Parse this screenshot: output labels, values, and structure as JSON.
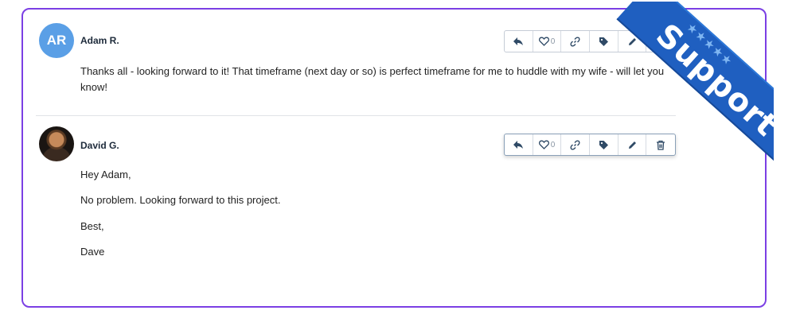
{
  "posts": [
    {
      "author": "Adam R.",
      "avatar_initials": "AR",
      "avatar_color": "#5a9fe6",
      "body": [
        "Thanks all - looking forward to it!  That timeframe (next day or so) is perfect timeframe for me to huddle with my wife - will let you know!"
      ],
      "like_count": "0"
    },
    {
      "author": "David G.",
      "body": [
        "Hey Adam,",
        "No problem. Looking forward to this project.",
        "Best,",
        "Dave"
      ],
      "like_count": "0"
    }
  ],
  "ribbon": {
    "label": "Support",
    "stars": "★★★★★",
    "color": "#1f5fc0"
  },
  "frame_color": "#7b3fe4"
}
